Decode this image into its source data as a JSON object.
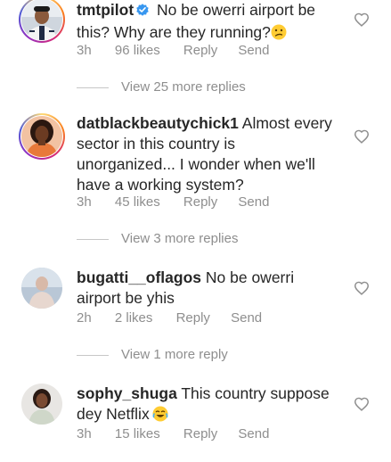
{
  "comments": [
    {
      "username": "tmtpilot",
      "verified": true,
      "text": "No be owerri airport be this? Why are they running?",
      "emoji": "confused-face",
      "time": "3h",
      "likes": "96 likes",
      "reply": "Reply",
      "send": "Send",
      "view_more": "View 25 more replies"
    },
    {
      "username": "datblackbeautychick1",
      "text": "Almost every sector in this country is unorganized... I wonder when we'll have a working system?",
      "time": "3h",
      "likes": "45 likes",
      "reply": "Reply",
      "send": "Send",
      "view_more": "View 3 more replies"
    },
    {
      "username": "bugatti__oflagos",
      "text": "No be owerri airport be yhis",
      "time": "2h",
      "likes": "2 likes",
      "reply": "Reply",
      "send": "Send",
      "view_more": "View 1 more reply"
    },
    {
      "username": "sophy_shuga",
      "text": "This country suppose dey Netflix",
      "emoji": "face-with-tears-of-joy",
      "time": "3h",
      "likes": "15 likes",
      "reply": "Reply",
      "send": "Send"
    }
  ],
  "colors": {
    "text": "#262626",
    "secondary": "#8e8e8e",
    "verified": "#3897f0"
  },
  "icons": {
    "like": "heart-outline-icon",
    "verified": "verified-badge-icon"
  }
}
